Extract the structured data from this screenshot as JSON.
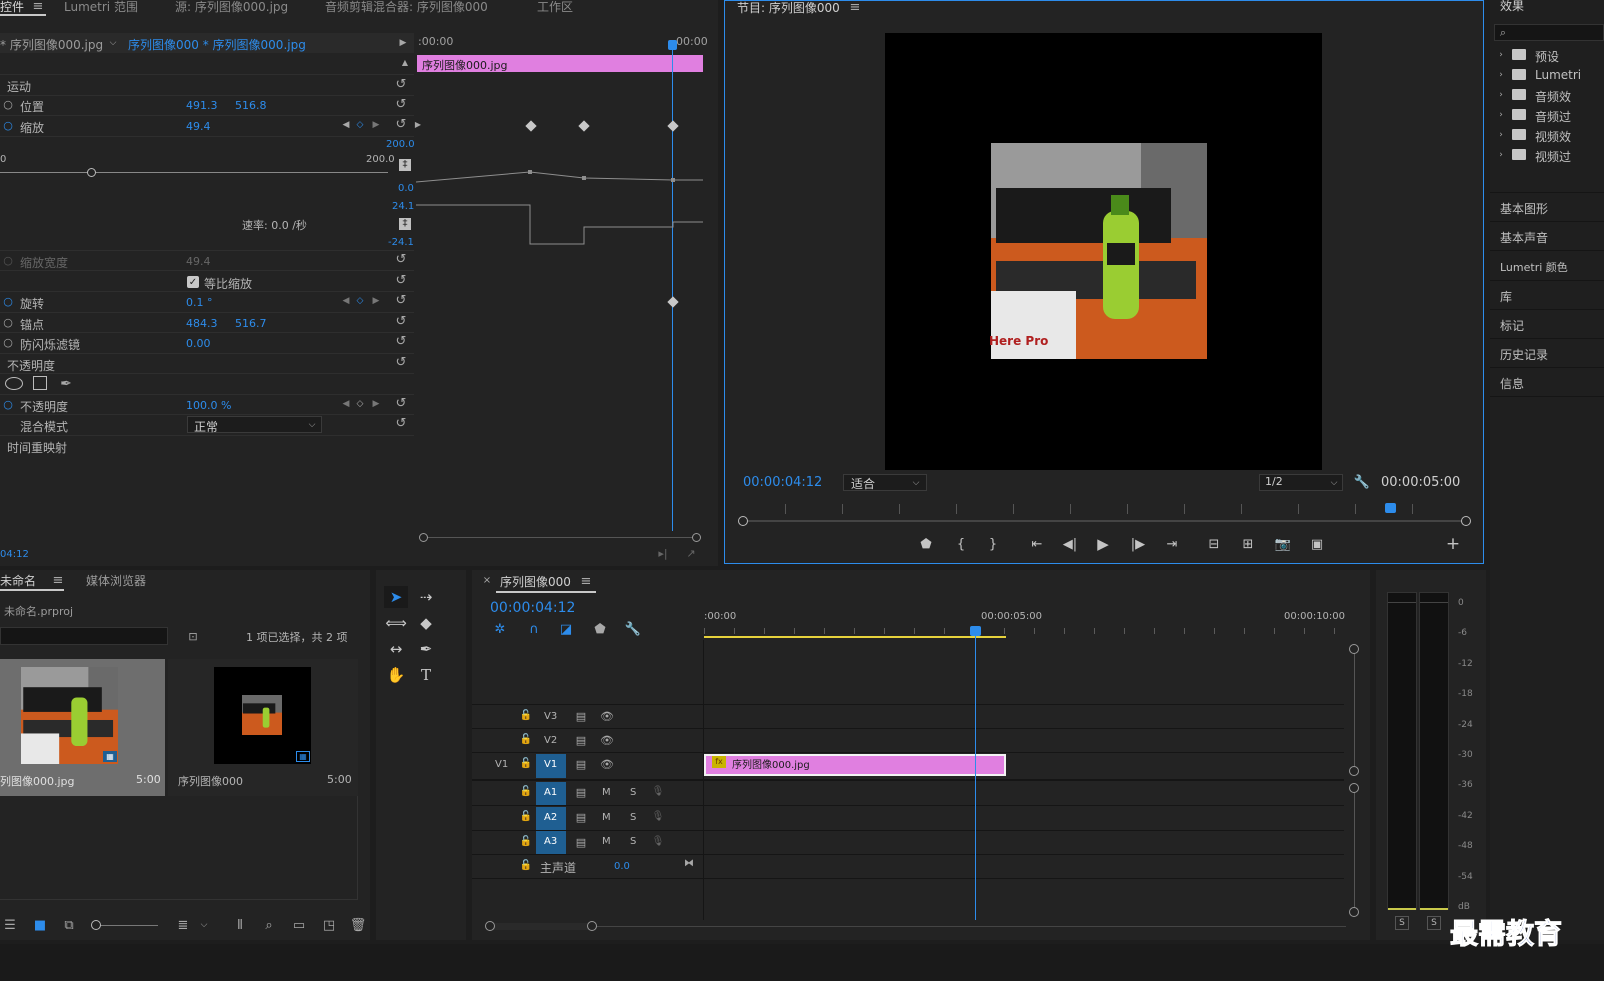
{
  "tabs_top": {
    "effect_controls": "控件",
    "lumetri_scope": "Lumetri 范围",
    "source": "源: 序列图像000.jpg",
    "audio_mixer": "音频剪辑混合器: 序列图像000",
    "workspace": "工作区"
  },
  "effect_controls": {
    "master_clip": "* 序列图像000.jpg",
    "sequence_clip": "序列图像000 * 序列图像000.jpg",
    "ruler_start": ":00:00",
    "ruler_end": "00:00",
    "clip_label": "序列图像000.jpg",
    "motion": "运动",
    "position": {
      "label": "位置",
      "x": "491.3",
      "y": "516.8"
    },
    "scale": {
      "label": "缩放",
      "value": "49.4"
    },
    "scale_max": "200.0",
    "slider_min": "0",
    "slider_max": "200.0",
    "graph_min": "0.0",
    "velocity_max": "24.1",
    "velocity_min": "-24.1",
    "rate": "速率: 0.0 /秒",
    "scale_width": {
      "label": "缩放宽度",
      "value": "49.4"
    },
    "uniform_scale": "等比缩放",
    "rotation": {
      "label": "旋转",
      "value": "0.1 °"
    },
    "anchor": {
      "label": "锚点",
      "x": "484.3",
      "y": "516.7"
    },
    "anti_flicker": {
      "label": "防闪烁滤镜",
      "value": "0.00"
    },
    "opacity_section": "不透明度",
    "opacity": {
      "label": "不透明度",
      "value": "100.0 %"
    },
    "blend_mode": {
      "label": "混合模式",
      "value": "正常"
    },
    "time_remap": "时间重映射",
    "timecode": "04:12"
  },
  "program": {
    "title": "节目: 序列图像000",
    "timecode": "00:00:04:12",
    "fit": "适合",
    "resolution": "1/2",
    "duration": "00:00:05:00",
    "frame_text": "Here Pro"
  },
  "effects_panel": {
    "title": "效果",
    "folders": [
      "预设",
      "Lumetri",
      "音频效",
      "音频过",
      "视频效",
      "视频过"
    ],
    "panels": [
      "基本图形",
      "基本声音",
      "Lumetri 颜色",
      "库",
      "标记",
      "历史记录",
      "信息"
    ]
  },
  "project": {
    "tab_project": "未命名",
    "tab_media": "媒体浏览器",
    "filename": "未命名.prproj",
    "selection": "1 项已选择，共 2 项",
    "items": [
      {
        "name": "列图像000.jpg",
        "duration": "5:00"
      },
      {
        "name": "序列图像000",
        "duration": "5:00"
      }
    ]
  },
  "timeline": {
    "title": "序列图像000",
    "timecode": "00:00:04:12",
    "ruler": [
      ":00:00",
      "00:00:05:00",
      "00:00:10:00"
    ],
    "video_tracks": [
      "V3",
      "V2",
      "V1"
    ],
    "source_patch": "V1",
    "audio_tracks": [
      "A1",
      "A2",
      "A3"
    ],
    "mute": "M",
    "solo": "S",
    "master": {
      "label": "主声道",
      "value": "0.0"
    },
    "clip": "序列图像000.jpg",
    "fx": "fx"
  },
  "meter": {
    "labels": [
      "0",
      "-6",
      "-12",
      "-18",
      "-24",
      "-30",
      "-36",
      "-42",
      "-48",
      "-54",
      "dB"
    ],
    "solo": "S"
  },
  "watermark": "最需教育",
  "colors": {
    "accent": "#2d8ceb",
    "clip": "#e07fe0",
    "track_blue": "#1f5f92"
  }
}
